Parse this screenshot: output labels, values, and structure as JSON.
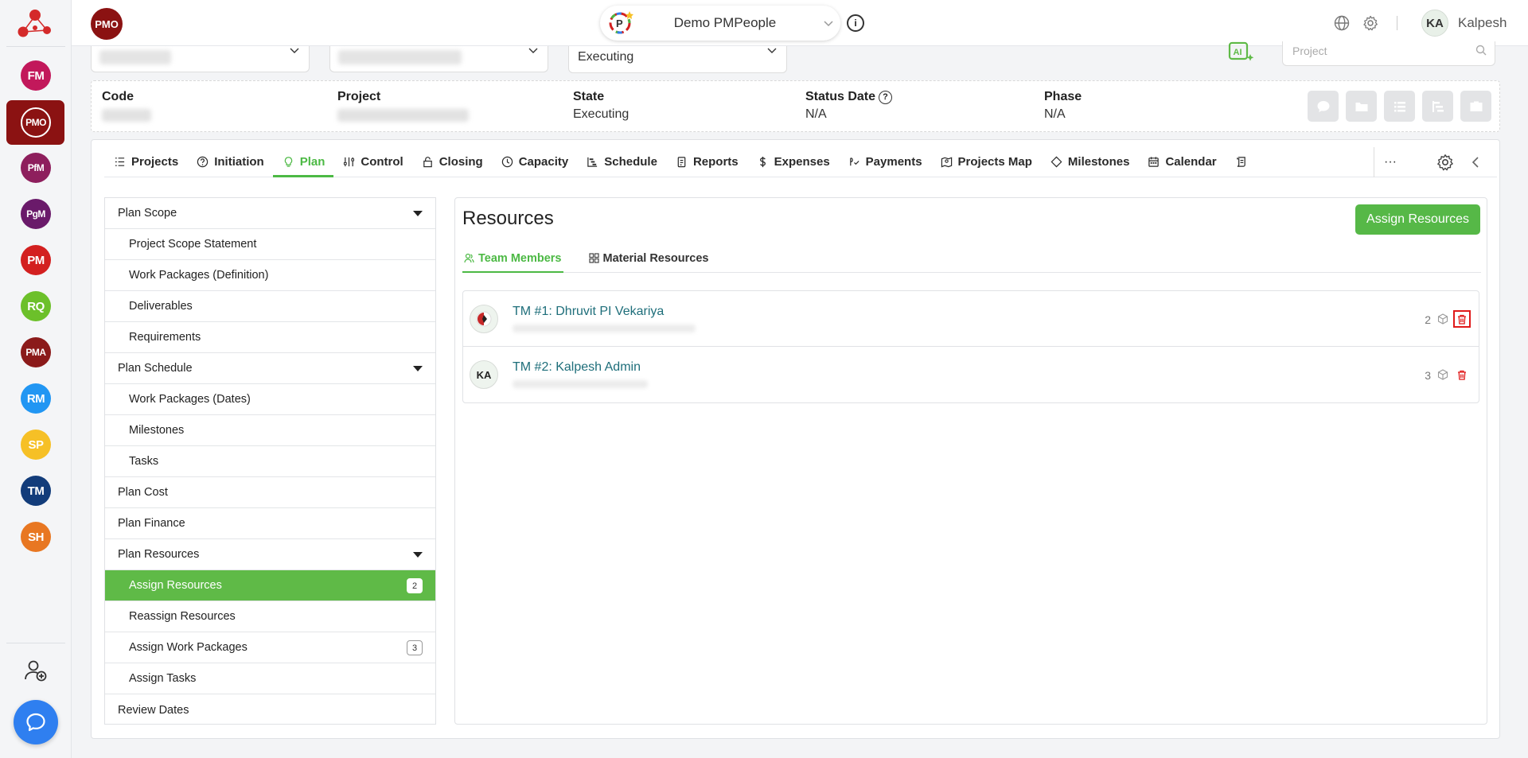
{
  "rail": {
    "apps": [
      {
        "label": "FM",
        "color": "#c2185b"
      },
      {
        "label": "PMO",
        "color": "#8b1212"
      },
      {
        "label": "PfM",
        "color": "#8e1f5d"
      },
      {
        "label": "PgM",
        "color": "#6a1a6a"
      },
      {
        "label": "PM",
        "color": "#d32020"
      },
      {
        "label": "RQ",
        "color": "#6cc02a"
      },
      {
        "label": "PMA",
        "color": "#8b1a1a"
      },
      {
        "label": "RM",
        "color": "#2196f3"
      },
      {
        "label": "SP",
        "color": "#f6c026"
      },
      {
        "label": "TM",
        "color": "#123c7a"
      },
      {
        "label": "SH",
        "color": "#e87722"
      }
    ]
  },
  "topbar": {
    "module_badge": "PMO",
    "org_name": "Demo PMPeople",
    "user_initials": "KA",
    "user_name": "Kalpesh"
  },
  "filters": {
    "state_value": "Executing",
    "search_placeholder": "Project"
  },
  "project_info": {
    "code_label": "Code",
    "project_label": "Project",
    "state_label": "State",
    "state_value": "Executing",
    "status_date_label": "Status Date",
    "status_date_value": "N/A",
    "phase_label": "Phase",
    "phase_value": "N/A"
  },
  "tabs": [
    {
      "label": "Projects",
      "icon": "list-icon"
    },
    {
      "label": "Initiation",
      "icon": "help-circle-icon"
    },
    {
      "label": "Plan",
      "icon": "bulb-icon"
    },
    {
      "label": "Control",
      "icon": "control-icon"
    },
    {
      "label": "Closing",
      "icon": "lock-icon"
    },
    {
      "label": "Capacity",
      "icon": "clock-icon"
    },
    {
      "label": "Schedule",
      "icon": "gantt-icon"
    },
    {
      "label": "Reports",
      "icon": "report-icon"
    },
    {
      "label": "Expenses",
      "icon": "dollar-icon"
    },
    {
      "label": "Payments",
      "icon": "payments-icon"
    },
    {
      "label": "Projects Map",
      "icon": "map-icon"
    },
    {
      "label": "Milestones",
      "icon": "diamond-icon"
    },
    {
      "label": "Calendar",
      "icon": "calendar-icon"
    }
  ],
  "more_label": "···",
  "sidenav": [
    {
      "label": "Plan Scope",
      "kind": "section",
      "expanded": true
    },
    {
      "label": "Project Scope Statement",
      "kind": "sub"
    },
    {
      "label": "Work Packages (Definition)",
      "kind": "sub"
    },
    {
      "label": "Deliverables",
      "kind": "sub"
    },
    {
      "label": "Requirements",
      "kind": "sub"
    },
    {
      "label": "Plan Schedule",
      "kind": "section",
      "expanded": true
    },
    {
      "label": "Work Packages (Dates)",
      "kind": "sub"
    },
    {
      "label": "Milestones",
      "kind": "sub"
    },
    {
      "label": "Tasks",
      "kind": "sub"
    },
    {
      "label": "Plan Cost",
      "kind": "section"
    },
    {
      "label": "Plan Finance",
      "kind": "section"
    },
    {
      "label": "Plan Resources",
      "kind": "section",
      "expanded": true
    },
    {
      "label": "Assign Resources",
      "kind": "sub",
      "active": true,
      "badge": "2"
    },
    {
      "label": "Reassign Resources",
      "kind": "sub"
    },
    {
      "label": "Assign Work Packages",
      "kind": "sub",
      "badge": "3"
    },
    {
      "label": "Assign Tasks",
      "kind": "sub"
    },
    {
      "label": "Review Dates",
      "kind": "section"
    }
  ],
  "resources": {
    "title": "Resources",
    "assign_button": "Assign Resources",
    "tab_team": "Team Members",
    "tab_material": "Material Resources",
    "members": [
      {
        "name": "TM #1: Dhruvit PI Vekariya",
        "avatar": "",
        "count": "2",
        "highlight_delete": true
      },
      {
        "name": "TM #2: Kalpesh Admin",
        "avatar": "KA",
        "count": "3",
        "highlight_delete": false
      }
    ]
  }
}
